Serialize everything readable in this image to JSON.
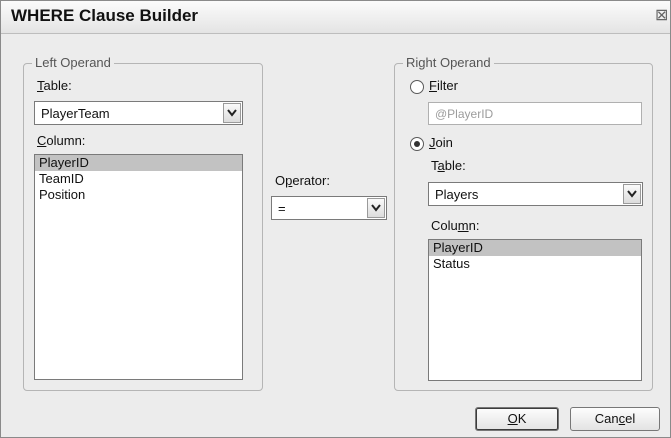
{
  "window": {
    "title": "WHERE Clause Builder",
    "close_glyph": "⊠"
  },
  "left_operand": {
    "legend": "Left Operand",
    "table_label": "Table:",
    "table_value": "PlayerTeam",
    "column_label": "Column:",
    "columns": [
      "PlayerID",
      "TeamID",
      "Position"
    ],
    "selected_column": "PlayerID"
  },
  "operator": {
    "label": "Operator:",
    "value": "="
  },
  "right_operand": {
    "legend": "Right Operand",
    "filter_label": "Filter",
    "filter_placeholder": "@PlayerID",
    "join_label": "Join",
    "selected_mode": "Join",
    "table_label": "Table:",
    "table_value": "Players",
    "column_label": "Column:",
    "columns": [
      "PlayerID",
      "Status"
    ],
    "selected_column": "PlayerID"
  },
  "buttons": {
    "ok": "OK",
    "cancel": "Cancel"
  },
  "icons": {
    "close": "close-icon",
    "dropdown": "chevron-down-icon"
  }
}
